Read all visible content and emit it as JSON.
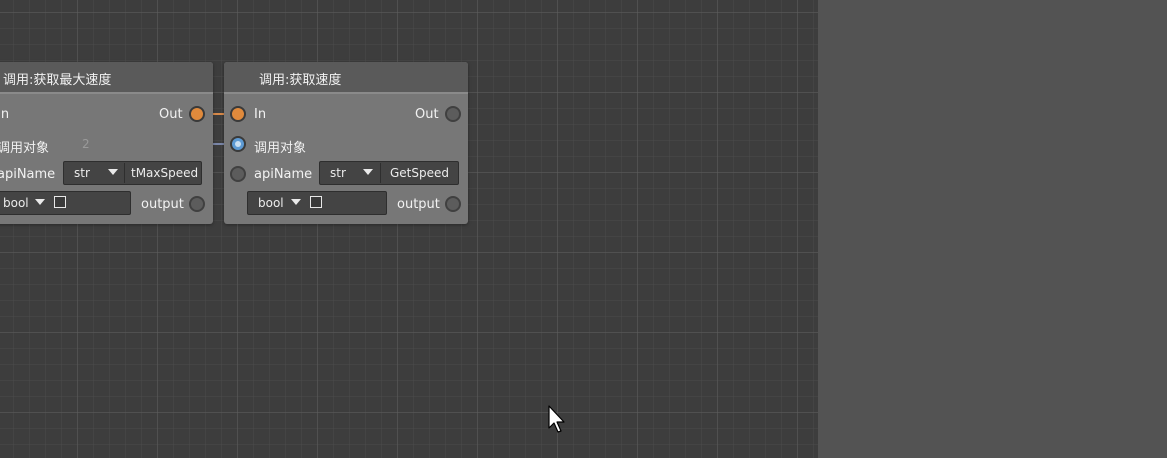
{
  "colors": {
    "canvas_bg": "#3d3d3d",
    "side_panel_bg": "#535353",
    "node_body": "#777777",
    "node_header": "#5a5a5a",
    "exec_port": "#e08a3c",
    "object_port": "#5d9ad3",
    "exec_wire": "#d88a4a",
    "object_wire": "#7a86a8"
  },
  "nodes": [
    {
      "title": "调用:获取最大速度",
      "in_label": "In",
      "out_label": "Out",
      "target_label": "调用对象",
      "wire_value": "2",
      "api_label": "apiName",
      "api_type": "str",
      "api_value": "tMaxSpeed",
      "return_type": "bool",
      "output_label": "output"
    },
    {
      "title": "调用:获取速度",
      "in_label": "In",
      "out_label": "Out",
      "target_label": "调用对象",
      "api_label": "apiName",
      "api_type": "str",
      "api_value": "GetSpeed",
      "return_type": "bool",
      "output_label": "output"
    }
  ]
}
